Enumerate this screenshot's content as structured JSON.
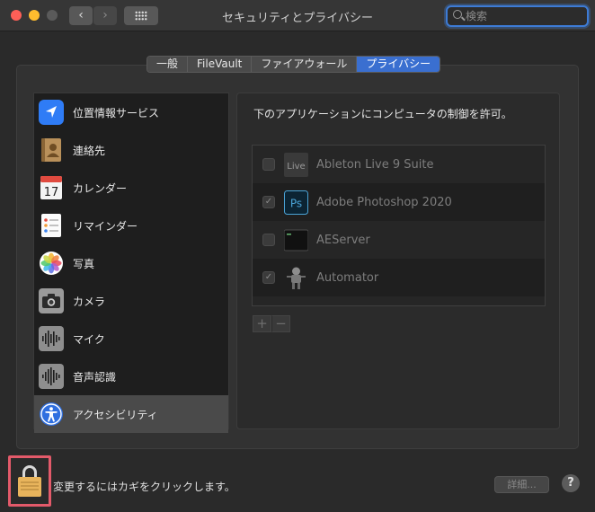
{
  "window": {
    "title": "セキュリティとプライバシー",
    "search_placeholder": "検索",
    "nav_back": "‹",
    "nav_forward": "›"
  },
  "tabs": [
    {
      "label": "一般",
      "active": false
    },
    {
      "label": "FileVault",
      "active": false
    },
    {
      "label": "ファイアウォール",
      "active": false
    },
    {
      "label": "プライバシー",
      "active": true
    }
  ],
  "sidebar": {
    "items": [
      {
        "label": "位置情報サービス",
        "icon": "location-arrow-icon"
      },
      {
        "label": "連絡先",
        "icon": "contacts-book-icon"
      },
      {
        "label": "カレンダー",
        "icon": "calendar-icon",
        "icon_text_top": "JUL",
        "icon_text_day": "17"
      },
      {
        "label": "リマインダー",
        "icon": "reminders-icon"
      },
      {
        "label": "写真",
        "icon": "photos-icon"
      },
      {
        "label": "カメラ",
        "icon": "camera-icon"
      },
      {
        "label": "マイク",
        "icon": "microphone-waveform-icon"
      },
      {
        "label": "音声認識",
        "icon": "speech-recognition-waveform-icon"
      },
      {
        "label": "アクセシビリティ",
        "icon": "accessibility-icon",
        "selected": true
      }
    ]
  },
  "main": {
    "heading": "下のアプリケーションにコンピュータの制御を許可。",
    "apps": [
      {
        "name": "Ableton Live 9 Suite",
        "checked": false,
        "icon": "ableton-live-icon",
        "icon_text": "Live"
      },
      {
        "name": "Adobe Photoshop 2020",
        "checked": true,
        "icon": "photoshop-icon",
        "icon_text": "Ps"
      },
      {
        "name": "AEServer",
        "checked": false,
        "icon": "aeserver-terminal-icon"
      },
      {
        "name": "Automator",
        "checked": true,
        "icon": "automator-robot-icon"
      }
    ],
    "add_label": "+",
    "remove_label": "−",
    "check_mark": "✓"
  },
  "footer": {
    "lock_text": "変更するにはカギをクリックします。",
    "details_label": "詳細...",
    "help_label": "?"
  },
  "colors": {
    "accent": "#3a6fd0",
    "lock_highlight": "#e35a6a"
  }
}
